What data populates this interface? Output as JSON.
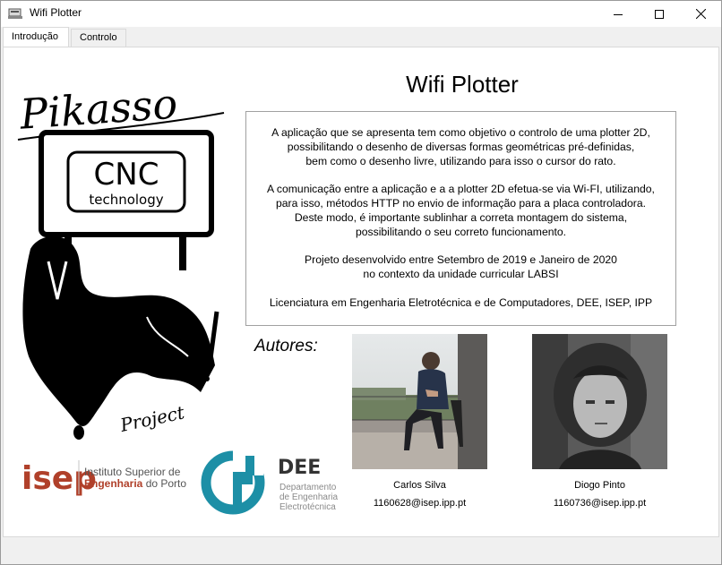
{
  "window": {
    "title": "Wifi Plotter"
  },
  "tabs": [
    {
      "label": "Introdução",
      "active": true
    },
    {
      "label": "Controlo",
      "active": false
    }
  ],
  "intro": {
    "heading": "Wifi Plotter",
    "paragraphs": [
      [
        "A aplicação que se apresenta tem como objetivo o controlo de uma plotter 2D,",
        "possibilitando o desenho de diversas formas geométricas pré-definidas,",
        "bem como o desenho livre, utilizando para isso o cursor do rato."
      ],
      [
        "A comunicação entre a aplicação e a a plotter 2D efetua-se via Wi-FI, utilizando,",
        "para isso, métodos HTTP no envio de informação para a placa controladora.",
        "Deste modo, é importante sublinhar a correta montagem do sistema,",
        "possibilitando o seu correto funcionamento."
      ],
      [
        "Projeto desenvolvido entre Setembro de 2019 e Janeiro de 2020",
        "no contexto da unidade curricular LABSI"
      ],
      [
        "Licenciatura em Engenharia Eletrotécnica e de Computadores, DEE, ISEP, IPP"
      ]
    ],
    "authors_label": "Autores:",
    "authors": [
      {
        "name": "Carlos Silva",
        "email": "1160628@isep.ipp.pt"
      },
      {
        "name": "Diogo Pinto",
        "email": "1160736@isep.ipp.pt"
      }
    ]
  },
  "logos": {
    "pikasso": {
      "title": "Pikasso",
      "cnc": "CNC",
      "technology": "technology",
      "project": "Project"
    },
    "isep": {
      "mark": "isep",
      "line1": "Instituto Superior de",
      "line2a": "Engenharia",
      "line2b": " do Porto"
    },
    "dee": {
      "mark": "DEE",
      "line1": "Departamento",
      "line2": "de Engenharia",
      "line3": "Electrotécnica"
    }
  },
  "colors": {
    "isep_red": "#b0402a",
    "dee_teal": "#1d8fa6",
    "dee_gray": "#8a8a8a"
  }
}
